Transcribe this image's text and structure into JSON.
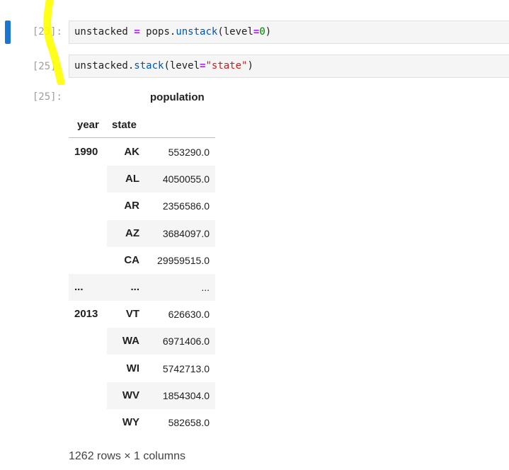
{
  "cells": [
    {
      "prompt": "[23]:",
      "code_parts": [
        {
          "text": "unstacked ",
          "cls": ""
        },
        {
          "text": "=",
          "cls": "kw-op"
        },
        {
          "text": " pops.",
          "cls": ""
        },
        {
          "text": "unstack",
          "cls": "kw-attr"
        },
        {
          "text": "(level",
          "cls": ""
        },
        {
          "text": "=",
          "cls": "kw-op"
        },
        {
          "text": "0",
          "cls": "kw-num"
        },
        {
          "text": ")",
          "cls": ""
        }
      ]
    },
    {
      "prompt": "[25]:",
      "code_parts": [
        {
          "text": "unstacked.",
          "cls": ""
        },
        {
          "text": "stack",
          "cls": "kw-attr"
        },
        {
          "text": "(level",
          "cls": ""
        },
        {
          "text": "=",
          "cls": "kw-op"
        },
        {
          "text": "\"state\"",
          "cls": "kw-str"
        },
        {
          "text": ")",
          "cls": ""
        }
      ]
    }
  ],
  "output": {
    "prompt": "[25]:",
    "column_header": "population",
    "index_names": [
      "year",
      "state"
    ],
    "rows": [
      {
        "year": "1990",
        "state": "AK",
        "value": "553290.0"
      },
      {
        "year": "",
        "state": "AL",
        "value": "4050055.0"
      },
      {
        "year": "",
        "state": "AR",
        "value": "2356586.0"
      },
      {
        "year": "",
        "state": "AZ",
        "value": "3684097.0"
      },
      {
        "year": "",
        "state": "CA",
        "value": "29959515.0"
      },
      {
        "year": "...",
        "state": "...",
        "value": "..."
      },
      {
        "year": "2013",
        "state": "VT",
        "value": "626630.0"
      },
      {
        "year": "",
        "state": "WA",
        "value": "6971406.0"
      },
      {
        "year": "",
        "state": "WI",
        "value": "5742713.0"
      },
      {
        "year": "",
        "state": "WV",
        "value": "1854304.0"
      },
      {
        "year": "",
        "state": "WY",
        "value": "582658.0"
      }
    ],
    "footer": "1262 rows × 1 columns"
  },
  "colors": {
    "active_indicator": "#1976d2",
    "highlighter": "#ffff00"
  }
}
